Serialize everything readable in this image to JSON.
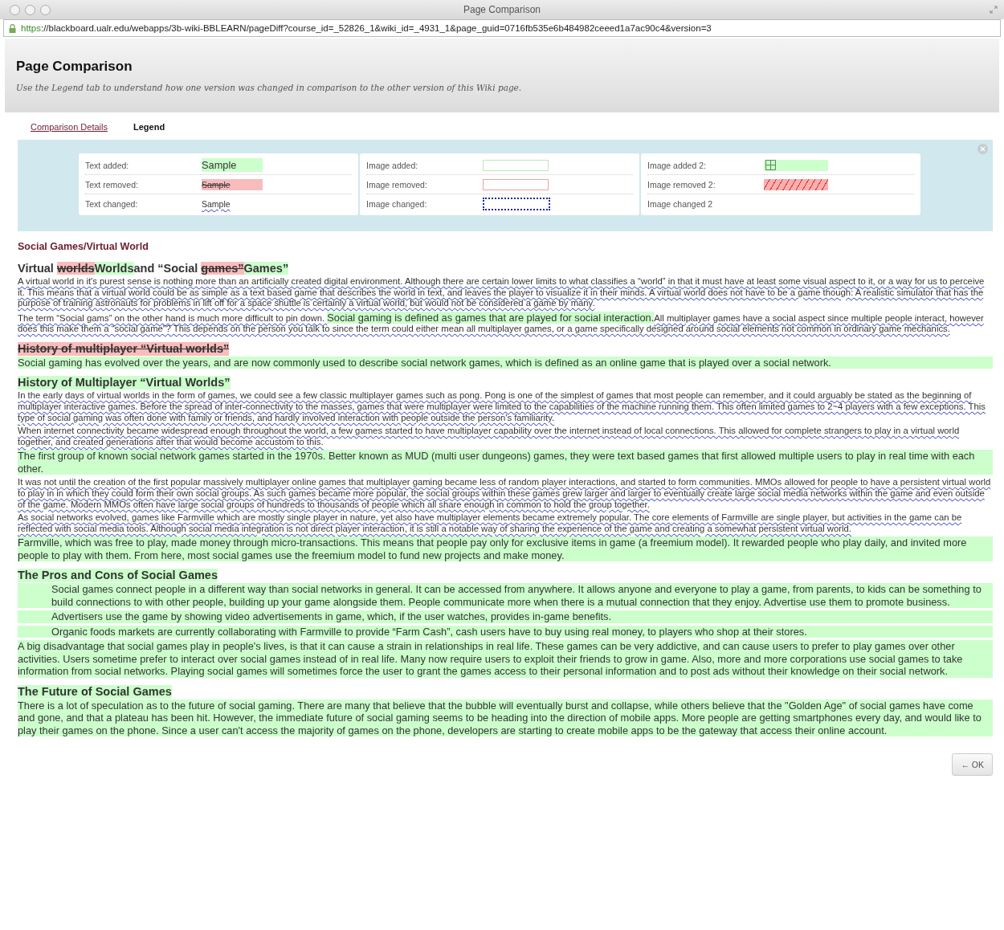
{
  "window": {
    "title": "Page Comparison",
    "url_scheme": "https",
    "url_rest": "://blackboard.ualr.edu/webapps/3b-wiki-BBLEARN/pageDiff?course_id=_52826_1&wiki_id=_4931_1&page_guid=0716fb535e6b484982ceeed1a7ac90c4&version=3"
  },
  "header": {
    "title": "Page Comparison",
    "subtitle": "Use the Legend tab to understand how one version was changed in comparison to the other version of this Wiki page."
  },
  "tabs": [
    {
      "label": "Comparison Details",
      "selected": false
    },
    {
      "label": "Legend",
      "selected": true
    }
  ],
  "legend": {
    "columns": [
      [
        {
          "label": "Text added:",
          "kind": "text_added",
          "sample": "Sample"
        },
        {
          "label": "Text removed:",
          "kind": "text_removed",
          "sample": "Sample"
        },
        {
          "label": "Text changed:",
          "kind": "text_changed",
          "sample": "Sample"
        }
      ],
      [
        {
          "label": "Image added:",
          "kind": "image_added"
        },
        {
          "label": "Image removed:",
          "kind": "image_removed"
        },
        {
          "label": "Image changed:",
          "kind": "image_changed"
        }
      ],
      [
        {
          "label": "Image added 2:",
          "kind": "image_added_2"
        },
        {
          "label": "Image removed 2:",
          "kind": "image_removed_2"
        },
        {
          "label": "Image changed 2",
          "kind": "none"
        }
      ]
    ]
  },
  "page_title": "Social Games/Virtual World",
  "blocks": [
    {
      "kind": "heading",
      "segments": [
        {
          "text": "Virtual ",
          "added": false,
          "removed": false,
          "changed": false
        },
        {
          "text": "worlds",
          "added": false,
          "removed": true,
          "changed": false
        },
        {
          "text": "Worlds",
          "added": true,
          "removed": false,
          "changed": false
        },
        {
          "text": "and “Social ",
          "added": false,
          "removed": false,
          "changed": false
        },
        {
          "text": "games”",
          "added": false,
          "removed": true,
          "changed": false
        },
        {
          "text": "Games”",
          "added": true,
          "removed": false,
          "changed": false
        }
      ]
    },
    {
      "kind": "paragraph",
      "added": false,
      "removed": false,
      "changed": true,
      "text": "A virtual world in it's purest sense is nothing more than an artificially created digital environment. Although there are certain lower limits to what classifies a “world” in that it must have at least some visual aspect to it, or a way for us to perceive it. This means that a virtual world could be as simple as a text based game that describes the world in text, and leaves the player to visualize it in their minds. A virtual world does not have to be a game though: A realistic simulator that has the purpose of training astronauts for problems in lift off for a space shuttle is certainly a virtual world, but would not be considered a game by many."
    },
    {
      "kind": "paragraph",
      "segments": [
        {
          "text": "The term “Social gams” on the other hand is much more difficult to pin down. ",
          "added": false,
          "removed": false,
          "changed": true
        },
        {
          "text": "Social gaming is defined as games that are played for social interaction.",
          "added": true,
          "removed": false,
          "changed": false
        },
        {
          "text": "All multiplayer games have a social aspect since multiple people interact, however does this make them a “social game”? This depends on the person you talk to since the term could either mean all multiplayer games, or a game specifically designed around social elements not common in ordinary game mechanics.",
          "added": false,
          "removed": false,
          "changed": true
        }
      ]
    },
    {
      "kind": "heading",
      "added": false,
      "removed": true,
      "changed": false,
      "text": "History of multiplayer “Virtual worlds”"
    },
    {
      "kind": "paragraph",
      "added": true,
      "removed": false,
      "changed": false,
      "text": "Social gaming has evolved over the years, and are now commonly used to describe social network games, which is defined as an online game that is played over a social network."
    },
    {
      "kind": "heading",
      "added": true,
      "removed": false,
      "changed": false,
      "text": "History of Multiplayer “Virtual Worlds”"
    },
    {
      "kind": "paragraph",
      "added": false,
      "removed": false,
      "changed": true,
      "text": "In the early days of virtual worlds in the form of games, we could see a few classic multiplayer games such as pong. Pong is one of the simplest of games that most people can remember, and it could arguably be stated as the beginning of multiplayer interactive games. Before the spread of inter-connectivity to the masses, games that were multiplayer were limited to the capabilities of the machine running them. This often limited games to 2~4 players with a few exceptions. This type of social gaming was often done with family or friends, and hardly involved interaction with people outside the person's familiarity."
    },
    {
      "kind": "paragraph",
      "added": false,
      "removed": false,
      "changed": true,
      "text": "When internet connectivity became widespread enough throughout the world, a few games started to have multiplayer capability over the internet instead of local connections. This allowed for complete strangers to play in a virtual world together, and created generations after that would become accustom to this."
    },
    {
      "kind": "paragraph",
      "added": true,
      "removed": false,
      "changed": false,
      "text": "The first group of known social network games started in the 1970s. Better known as MUD (multi user dungeons) games, they were text based games that first allowed multiple users to play in real time with each other."
    },
    {
      "kind": "paragraph",
      "added": false,
      "removed": false,
      "changed": true,
      "text": "It was not until the creation of the first popular massively multiplayer online games that multiplayer gaming became less of random player interactions, and started to form communities. MMOs allowed for people to have a persistent virtual world to play in in which they could form their own social groups. As such games became more popular, the social groups within these games grew larger and larger to eventually create large social media networks within the game and even outside of the game. Modern MMOs often have large social groups of hundreds to thousands of people which all share enough in common to hold the group together."
    },
    {
      "kind": "paragraph",
      "added": false,
      "removed": false,
      "changed": true,
      "text": "As social networks evolved, games like Farmville which are mostly single player in nature, yet also have multiplayer elements became extremely popular. The core elements of Farmville are single player, but activities in the game can be reflected with social media tools. Although social media integration is not direct player interaction, it is still a notable way of sharing the experience of the game and creating a somewhat persistent virtual world."
    },
    {
      "kind": "paragraph",
      "added": true,
      "removed": false,
      "changed": false,
      "text": "Farmville, which was free to play, made money through micro-transactions. This means that people pay only for exclusive items in game (a freemium model). It rewarded people who play daily, and invited more people to play with them. From here, most social games use the freemium model to fund new projects and make money."
    },
    {
      "kind": "heading",
      "added": true,
      "removed": false,
      "changed": false,
      "text": "The Pros and Cons of Social Games"
    },
    {
      "kind": "item",
      "added": true,
      "removed": false,
      "changed": false,
      "text": "Social games connect people in a different way than social networks in general. It can be accessed from anywhere. It allows anyone and everyone to play a game, from parents, to kids can be something to build connections to with other people, building up your game alongside them. People communicate more when there is a mutual connection that they enjoy. Advertise use them to promote business."
    },
    {
      "kind": "item",
      "added": true,
      "removed": false,
      "changed": false,
      "text": "Advertisers use the game by showing video advertisements in game, which, if the user watches, provides in-game benefits."
    },
    {
      "kind": "item",
      "added": true,
      "removed": false,
      "changed": false,
      "text": "Organic foods markets are currently collaborating with Farmville to provide “Farm Cash”, cash users have to buy using real money, to players who shop at their stores."
    },
    {
      "kind": "paragraph",
      "added": true,
      "removed": false,
      "changed": false,
      "text": "A big disadvantage that social games play in people's lives, is that it can cause a strain in relationships in real life. These games can be very addictive, and can cause users to prefer to play games over other activities. Users sometime prefer to interact over social games instead of in real life. Many now require users to exploit their friends to grow in game. Also, more and more corporations use social games to take information from social networks. Playing social games will sometimes force the user to grant the games access to their personal information and to post ads without their knowledge on their social network."
    },
    {
      "kind": "heading",
      "added": true,
      "removed": false,
      "changed": false,
      "text": "The Future of Social Games"
    },
    {
      "kind": "paragraph",
      "added": true,
      "removed": false,
      "changed": false,
      "text": "There is a lot of speculation as to the future of social gaming. There are many that believe that the bubble will eventually burst and collapse, while others believe that the \"Golden Age\" of social games have come and gone, and that a plateau has been hit. However, the immediate future of social gaming seems to be heading into the direction of mobile apps. More people are getting smartphones every day, and would like to play their games on the phone. Since a user can't access the majority of games on the phone, developers are starting to create mobile apps to be the gateway that access their online account."
    }
  ],
  "ok_button": "← OK"
}
